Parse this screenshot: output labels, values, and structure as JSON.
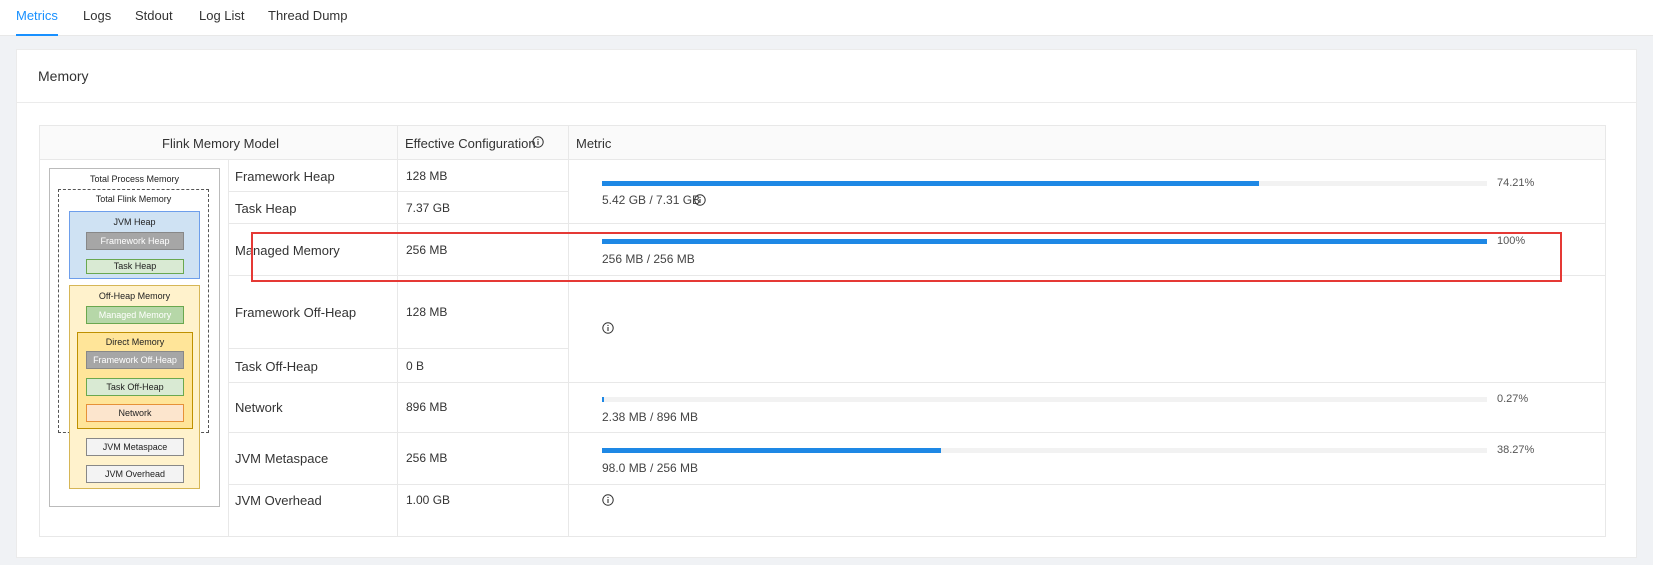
{
  "tabs": [
    "Metrics",
    "Logs",
    "Stdout",
    "Log List",
    "Thread Dump"
  ],
  "active_tab": "Metrics",
  "card": {
    "title": "Memory"
  },
  "table": {
    "headers": {
      "model": "Flink Memory Model",
      "config": "Effective Configuration",
      "metric": "Metric"
    },
    "rows": [
      {
        "label": "Framework Heap",
        "config": "128 MB"
      },
      {
        "label": "Task Heap",
        "config": "7.37 GB"
      },
      {
        "label": "Managed Memory",
        "config": "256 MB"
      },
      {
        "label": "Framework Off-Heap",
        "config": "128 MB"
      },
      {
        "label": "Task Off-Heap",
        "config": "0 B"
      },
      {
        "label": "Network",
        "config": "896 MB"
      },
      {
        "label": "JVM Metaspace",
        "config": "256 MB"
      },
      {
        "label": "JVM Overhead",
        "config": "1.00 GB"
      }
    ],
    "metrics": {
      "heap": {
        "value": "5.42 GB / 7.31 GB",
        "percent": "74.21%",
        "fraction": 0.7421
      },
      "managed": {
        "value": "256 MB / 256 MB",
        "percent": "100%",
        "fraction": 1.0
      },
      "network": {
        "value": "2.38 MB / 896 MB",
        "percent": "0.27%",
        "fraction": 0.0027
      },
      "metaspace": {
        "value": "98.0 MB / 256 MB",
        "percent": "38.27%",
        "fraction": 0.3827
      }
    }
  },
  "diagram": {
    "total_process": "Total Process Memory",
    "total_flink": "Total Flink Memory",
    "jvm_heap": "JVM Heap",
    "framework_heap": "Framework Heap",
    "task_heap": "Task Heap",
    "off_heap": "Off-Heap Memory",
    "managed_memory": "Managed Memory",
    "direct_memory": "Direct Memory",
    "framework_off_heap": "Framework Off-Heap",
    "task_off_heap": "Task Off-Heap",
    "network": "Network",
    "jvm_metaspace": "JVM Metaspace",
    "jvm_overhead": "JVM Overhead"
  },
  "colors": {
    "accent": "#1890ff",
    "bar": "#1e88e5",
    "highlight": "#e53935",
    "jvm_heap_bg": "#cfe2f3",
    "off_heap_bg": "#fff2cc",
    "direct_bg": "#ffe599",
    "gray_box": "#a6a6a6",
    "green_box": "#d9ead3",
    "managed_box": "#b6d7a8",
    "network_box": "#fce5cd"
  },
  "icons": [
    "info-icon"
  ]
}
